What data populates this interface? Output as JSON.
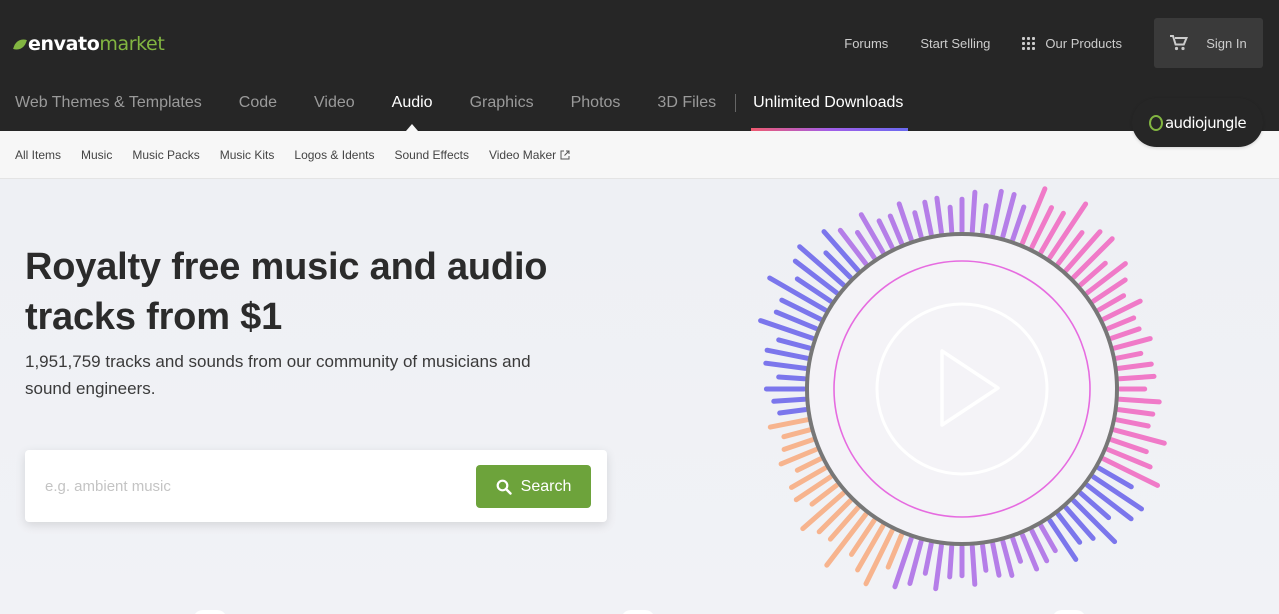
{
  "brand": {
    "logo_primary": "envato",
    "logo_secondary": "market",
    "accent": "#82b541"
  },
  "toplinks": {
    "forums": "Forums",
    "start_selling": "Start Selling",
    "our_products": "Our Products",
    "sign_in": "Sign In"
  },
  "categories": [
    {
      "label": "Web Themes & Templates"
    },
    {
      "label": "Code"
    },
    {
      "label": "Video"
    },
    {
      "label": "Audio",
      "active": true
    },
    {
      "label": "Graphics"
    },
    {
      "label": "Photos"
    },
    {
      "label": "3D Files"
    },
    {
      "label": "Unlimited Downloads"
    }
  ],
  "site_badge": {
    "label": "audiojungle"
  },
  "subnav": [
    {
      "label": "All Items"
    },
    {
      "label": "Music"
    },
    {
      "label": "Music Packs"
    },
    {
      "label": "Music Kits"
    },
    {
      "label": "Logos & Idents"
    },
    {
      "label": "Sound Effects"
    },
    {
      "label": "Video Maker",
      "icon": "external-link-icon"
    }
  ],
  "hero": {
    "title_line1": "Royalty free music and audio",
    "title_line2": "tracks from $1",
    "subtitle_line1": "1,951,759 tracks and sounds from our community of musicians and",
    "subtitle_line2": "sound engineers."
  },
  "search": {
    "placeholder": "e.g. ambient music",
    "value": "",
    "button_label": "Search",
    "button_color": "#6da33b"
  },
  "icons": [
    "grid-icon",
    "cart-icon",
    "search-icon",
    "external-link-icon",
    "play-icon"
  ],
  "visualizer_colors": [
    "#f07ac8",
    "#b57ee8",
    "#7b76ec",
    "#f7b48e"
  ]
}
